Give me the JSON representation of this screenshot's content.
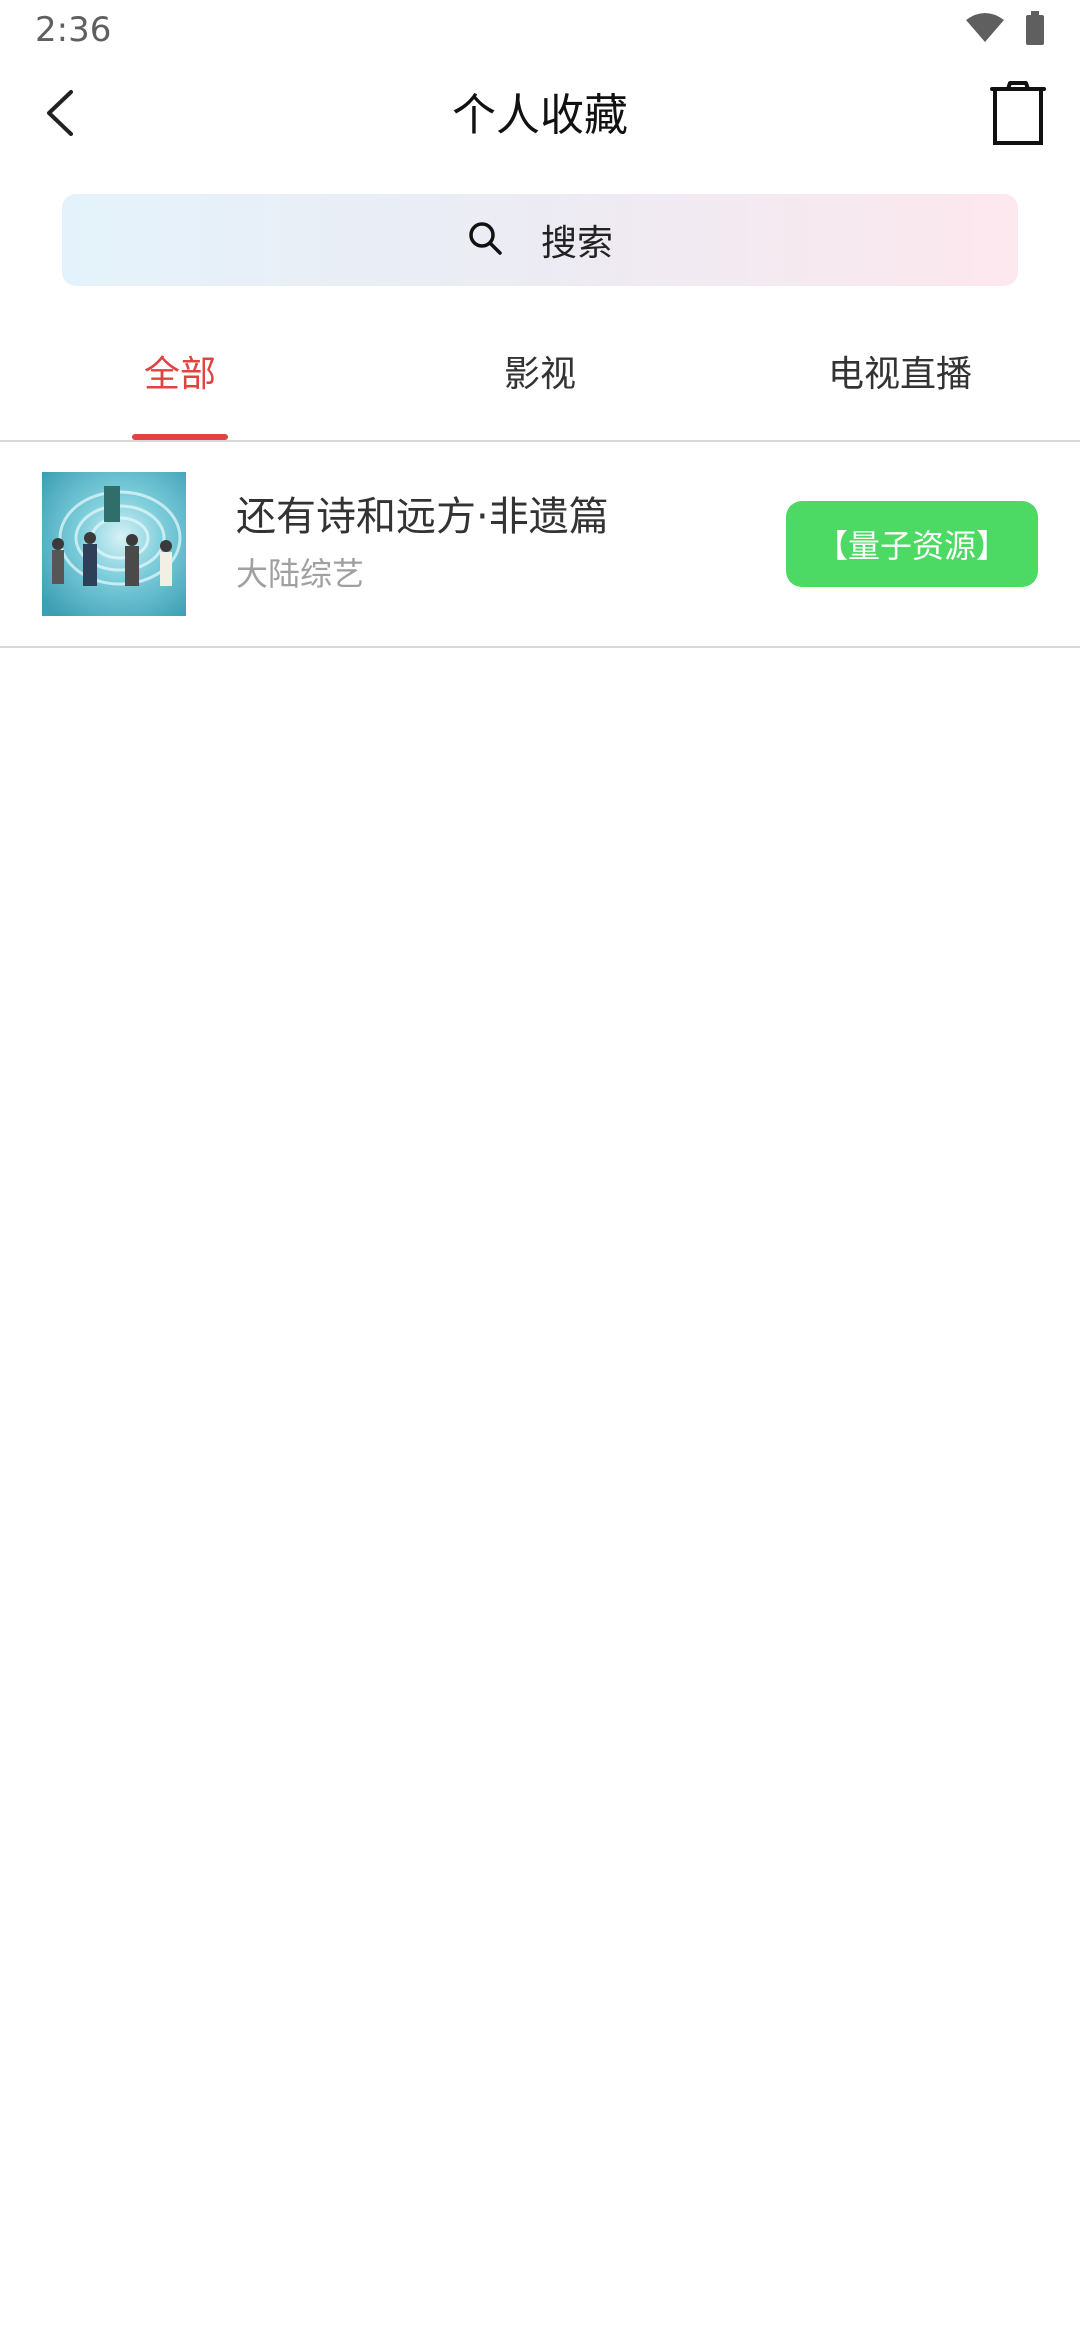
{
  "status_bar": {
    "time": "2:36",
    "icons": [
      "wifi-icon",
      "battery-icon"
    ]
  },
  "header": {
    "title": "个人收藏",
    "back_icon": "back-chevron-icon",
    "trash_icon": "trash-icon"
  },
  "search": {
    "label": "搜索",
    "icon": "search-icon"
  },
  "tabs": [
    {
      "label": "全部",
      "active": true
    },
    {
      "label": "影视",
      "active": false
    },
    {
      "label": "电视直播",
      "active": false
    }
  ],
  "favorites": [
    {
      "title": "还有诗和远方·非遗篇",
      "category": "大陆综艺",
      "source_button": "【量子资源】"
    }
  ],
  "colors": {
    "accent_red": "#e0443f",
    "source_green": "#4cd964",
    "search_gradient_start": "#e4f3fb",
    "search_gradient_end": "#fde8ee"
  }
}
